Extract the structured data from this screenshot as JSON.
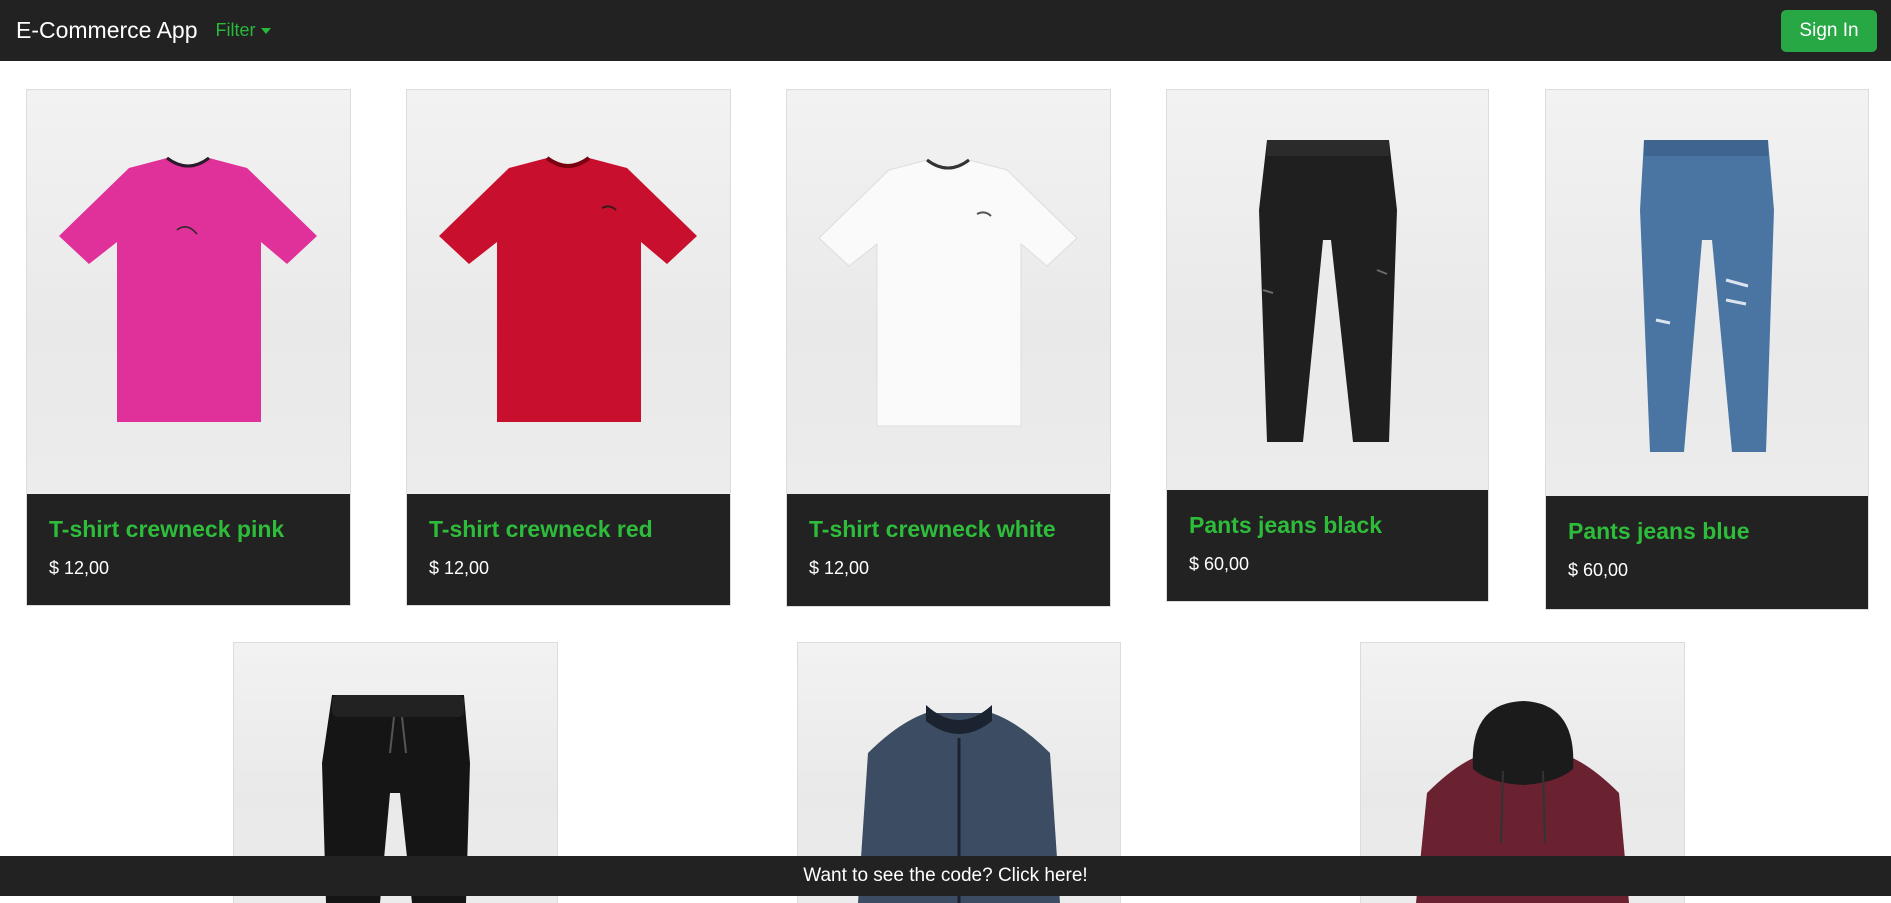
{
  "app": {
    "brand": "E-Commerce App",
    "filter_label": "Filter",
    "signin_label": "Sign In"
  },
  "products": [
    {
      "title": "T-shirt crewneck pink",
      "price": "$ 12,00",
      "image": "pink-tshirt"
    },
    {
      "title": "T-shirt crewneck red",
      "price": "$ 12,00",
      "image": "red-tshirt"
    },
    {
      "title": "T-shirt crewneck white",
      "price": "$ 12,00",
      "image": "white-tshirt"
    },
    {
      "title": "Pants jeans black",
      "price": "$ 60,00",
      "image": "black-jeans"
    },
    {
      "title": "Pants jeans blue",
      "price": "$ 60,00",
      "image": "blue-jeans"
    },
    {
      "title": "",
      "price": "",
      "image": "black-joggers"
    },
    {
      "title": "",
      "price": "",
      "image": "navy-bomber-jacket"
    },
    {
      "title": "",
      "price": "",
      "image": "burgundy-hooded-jacket"
    }
  ],
  "footer": {
    "label": "Want to see the code? Click here!"
  },
  "colors": {
    "navbar_bg": "#222222",
    "accent_green": "#28a745",
    "title_green": "#2ebd3a",
    "pink": "#e0309a",
    "red": "#c8102e",
    "white_shirt": "#fafafa",
    "black_jeans": "#1f1f1f",
    "blue_jeans": "#4a75a3",
    "navy_jacket": "#3b4c63",
    "burgundy_jacket": "#6b2230"
  }
}
